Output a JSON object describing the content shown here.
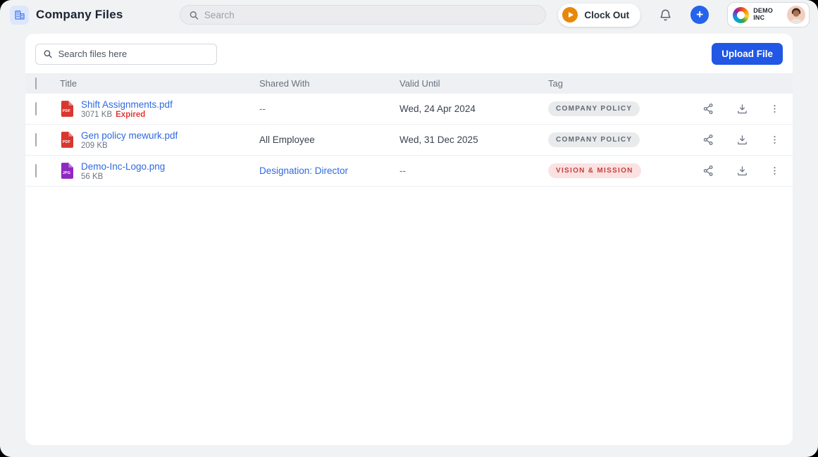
{
  "topbar": {
    "title": "Company Files",
    "search_placeholder": "Search",
    "clock_out_label": "Clock Out",
    "company": {
      "line1": "DEMO",
      "line2": "INC"
    }
  },
  "toolbar": {
    "search_placeholder": "Search files here",
    "upload_label": "Upload File"
  },
  "table": {
    "columns": {
      "title": "Title",
      "shared_with": "Shared With",
      "valid_until": "Valid Until",
      "tag": "Tag"
    },
    "rows": [
      {
        "title": "Shift Assignments.pdf",
        "file_type": "PDF",
        "icon_color": "#d8362f",
        "size": "3071 KB",
        "status": "Expired",
        "shared_with": "--",
        "shared_with_is_link": false,
        "valid_until": "Wed, 24 Apr 2024",
        "tag": "COMPANY POLICY",
        "tag_style": "gray"
      },
      {
        "title": "Gen policy mewurk.pdf",
        "file_type": "PDF",
        "icon_color": "#d8362f",
        "size": "209 KB",
        "status": "",
        "shared_with": "All Employee",
        "shared_with_is_link": false,
        "valid_until": "Wed, 31 Dec 2025",
        "tag": "COMPANY POLICY",
        "tag_style": "gray"
      },
      {
        "title": "Demo-Inc-Logo.png",
        "file_type": "JPG",
        "icon_color": "#9028c4",
        "size": "56 KB",
        "status": "",
        "shared_with": "Designation: Director",
        "shared_with_is_link": true,
        "valid_until": "--",
        "tag": "VISION & MISSION",
        "tag_style": "pink"
      }
    ]
  },
  "colors": {
    "accent_blue": "#2563eb",
    "link_blue": "#2e6ae0",
    "expired_red": "#e03b3b",
    "clockout_orange": "#e8880b",
    "pdf_red": "#d8362f",
    "jpg_purple": "#9028c4"
  }
}
